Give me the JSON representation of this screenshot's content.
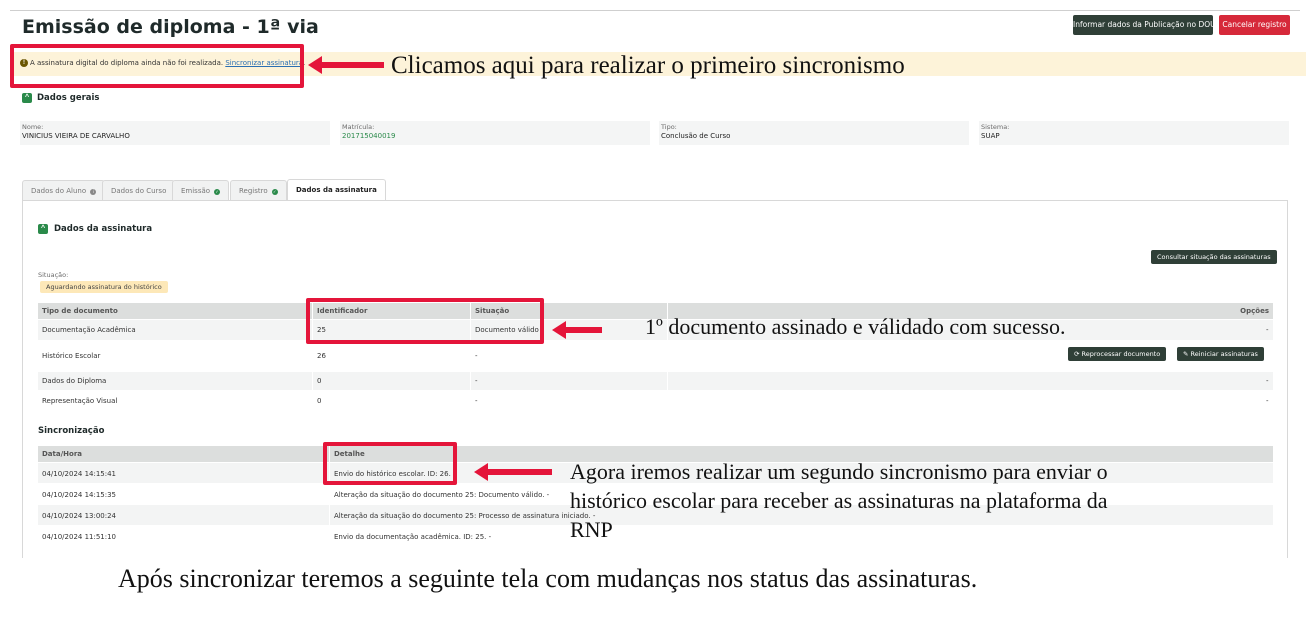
{
  "header": {
    "title": "Emissão de diploma - 1ª via",
    "btn_publicacao": "Informar dados da Publicação no DOU",
    "btn_cancelar": "Cancelar registro"
  },
  "alert": {
    "text": "A assinatura digital do diploma ainda não foi realizada.",
    "link": "Sincronizar assinatura",
    "link_suffix": "."
  },
  "dados_gerais": {
    "title": "Dados gerais",
    "fields": [
      {
        "label": "Nome:",
        "value": "VINICIUS VIEIRA DE CARVALHO"
      },
      {
        "label": "Matrícula:",
        "value": "201715040019"
      },
      {
        "label": "Tipo:",
        "value": "Conclusão de Curso"
      },
      {
        "label": "Sistema:",
        "value": "SUAP"
      }
    ]
  },
  "tabs": [
    {
      "label": "Dados do Aluno",
      "status": "info"
    },
    {
      "label": "Dados do Curso",
      "status": ""
    },
    {
      "label": "Emissão",
      "status": "ok"
    },
    {
      "label": "Registro",
      "status": "ok"
    },
    {
      "label": "Dados da assinatura",
      "status": "active"
    }
  ],
  "assinatura": {
    "title": "Dados da assinatura",
    "btn_consultar": "Consultar situação das assinaturas",
    "situacao_label": "Situação:",
    "situacao_value": "Aguardando assinatura do histórico",
    "columns": [
      "Tipo de documento",
      "Identificador",
      "Situação",
      "Opções"
    ],
    "rows": [
      {
        "tipo": "Documentação Acadêmica",
        "id": "25",
        "situacao": "Documento válido",
        "opcoes": "-"
      },
      {
        "tipo": "Histórico Escolar",
        "id": "26",
        "situacao": "-",
        "opcoes": ""
      },
      {
        "tipo": "Dados do Diploma",
        "id": "0",
        "situacao": "-",
        "opcoes": "-"
      },
      {
        "tipo": "Representação Visual",
        "id": "0",
        "situacao": "-",
        "opcoes": "-"
      }
    ],
    "btn_reprocessar": "Reprocessar documento",
    "btn_reiniciar": "Reiniciar assinaturas"
  },
  "sincronizacao": {
    "title": "Sincronização",
    "columns": [
      "Data/Hora",
      "Detalhe"
    ],
    "rows": [
      {
        "data": "04/10/2024 14:15:41",
        "detalhe": "Envio do histórico escolar. ID: 26. -"
      },
      {
        "data": "04/10/2024 14:15:35",
        "detalhe": "Alteração da situação do documento 25: Documento válido. -"
      },
      {
        "data": "04/10/2024 13:00:24",
        "detalhe": "Alteração da situação do documento 25: Processo de assinatura iniciado. -"
      },
      {
        "data": "04/10/2024 11:51:10",
        "detalhe": "Envio da documentação acadêmica. ID: 25. -"
      }
    ]
  },
  "annotations": {
    "a1": "Clicamos aqui para realizar o primeiro sincronismo",
    "a2": "1º documento assinado e válidado com sucesso.",
    "a3_line1": "Agora iremos realizar um segundo sincronismo para enviar o",
    "a3_line2": "histórico escolar para receber as assinaturas na plataforma da",
    "a3_line3": "RNP",
    "caption": "Após sincronizar teremos a seguinte tela com mudanças nos status das assinaturas."
  },
  "colors": {
    "accent_green": "#2a8a4a",
    "annotation_red": "#e4153a",
    "danger": "#d6293a",
    "dark_button": "#2f3f37"
  }
}
